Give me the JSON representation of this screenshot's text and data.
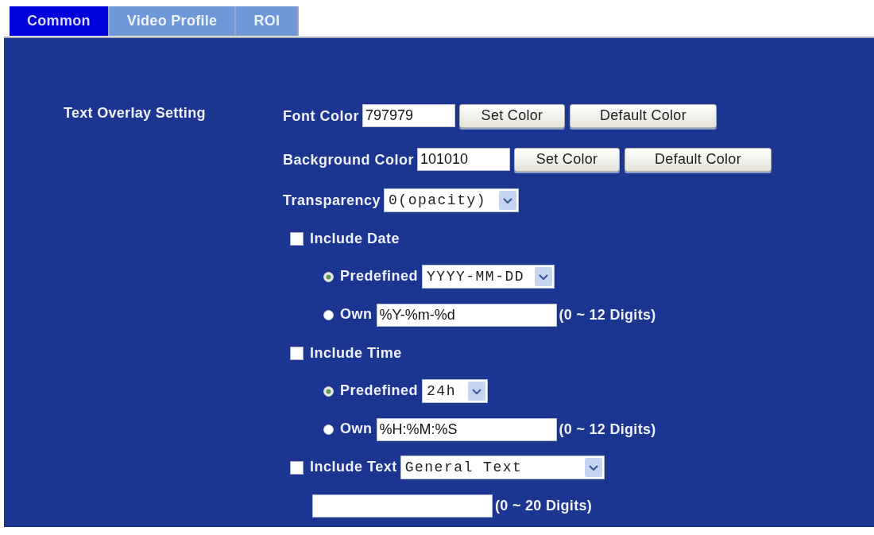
{
  "tabs": [
    {
      "label": "Common",
      "selected": true
    },
    {
      "label": "Video Profile",
      "selected": false
    },
    {
      "label": "ROI",
      "selected": false
    }
  ],
  "text_overlay": {
    "title": "Text Overlay Setting",
    "rows": [
      {
        "kind": "color",
        "label": "Font Color",
        "value": "797979",
        "buttons": [
          "Set Color",
          "Default Color"
        ]
      },
      {
        "kind": "color",
        "label": "Background Color",
        "value": "101010",
        "buttons": [
          "Set Color",
          "Default Color"
        ]
      },
      {
        "kind": "select",
        "label": "Transparency",
        "value": "0(opacity)"
      },
      {
        "kind": "checkbox",
        "label": "Include Date",
        "checked": false
      },
      {
        "kind": "radio_select",
        "label": "Predefined",
        "selected": true,
        "value": "YYYY-MM-DD"
      },
      {
        "kind": "radio_input",
        "label": "Own",
        "selected": false,
        "value": "%Y-%m-%d",
        "hint": "(0 ~ 12 Digits)"
      },
      {
        "kind": "checkbox",
        "label": "Include Time",
        "checked": false
      },
      {
        "kind": "radio_select",
        "label": "Predefined",
        "selected": true,
        "value": "24h"
      },
      {
        "kind": "radio_input",
        "label": "Own",
        "selected": false,
        "value": "%H:%M:%S",
        "hint": "(0 ~ 12 Digits)"
      },
      {
        "kind": "checkbox_select",
        "label": "Include Text",
        "checked": false,
        "value": "General Text"
      },
      {
        "kind": "input",
        "hint": "(0 ~ 20 Digits)"
      }
    ]
  }
}
